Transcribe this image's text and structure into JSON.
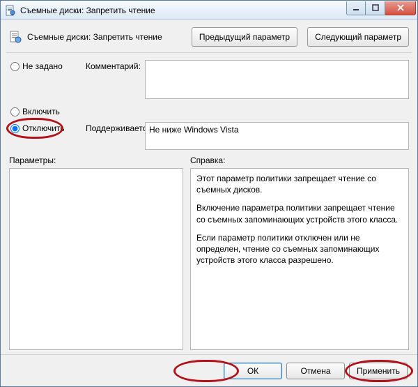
{
  "window": {
    "title": "Съемные диски: Запретить чтение"
  },
  "header": {
    "policy_title": "Съемные диски: Запретить чтение",
    "prev_btn": "Предыдущий параметр",
    "next_btn": "Следующий параметр"
  },
  "state": {
    "not_configured": "Не задано",
    "enabled": "Включить",
    "disabled": "Отключить",
    "selected": "disabled"
  },
  "labels": {
    "comment": "Комментарий:",
    "supported": "Поддерживается:",
    "options": "Параметры:",
    "help": "Справка:"
  },
  "fields": {
    "comment": "",
    "supported": "Не ниже Windows Vista"
  },
  "help": {
    "p1": "Этот параметр политики запрещает чтение со съемных дисков.",
    "p2": "Включение параметра политики запрещает чтение со съемных запоминающих устройств этого класса.",
    "p3": "Если параметр политики отключен или не определен, чтение со съемных запоминающих устройств этого класса разрешено."
  },
  "footer": {
    "ok": "ОК",
    "cancel": "Отмена",
    "apply": "Применить"
  }
}
